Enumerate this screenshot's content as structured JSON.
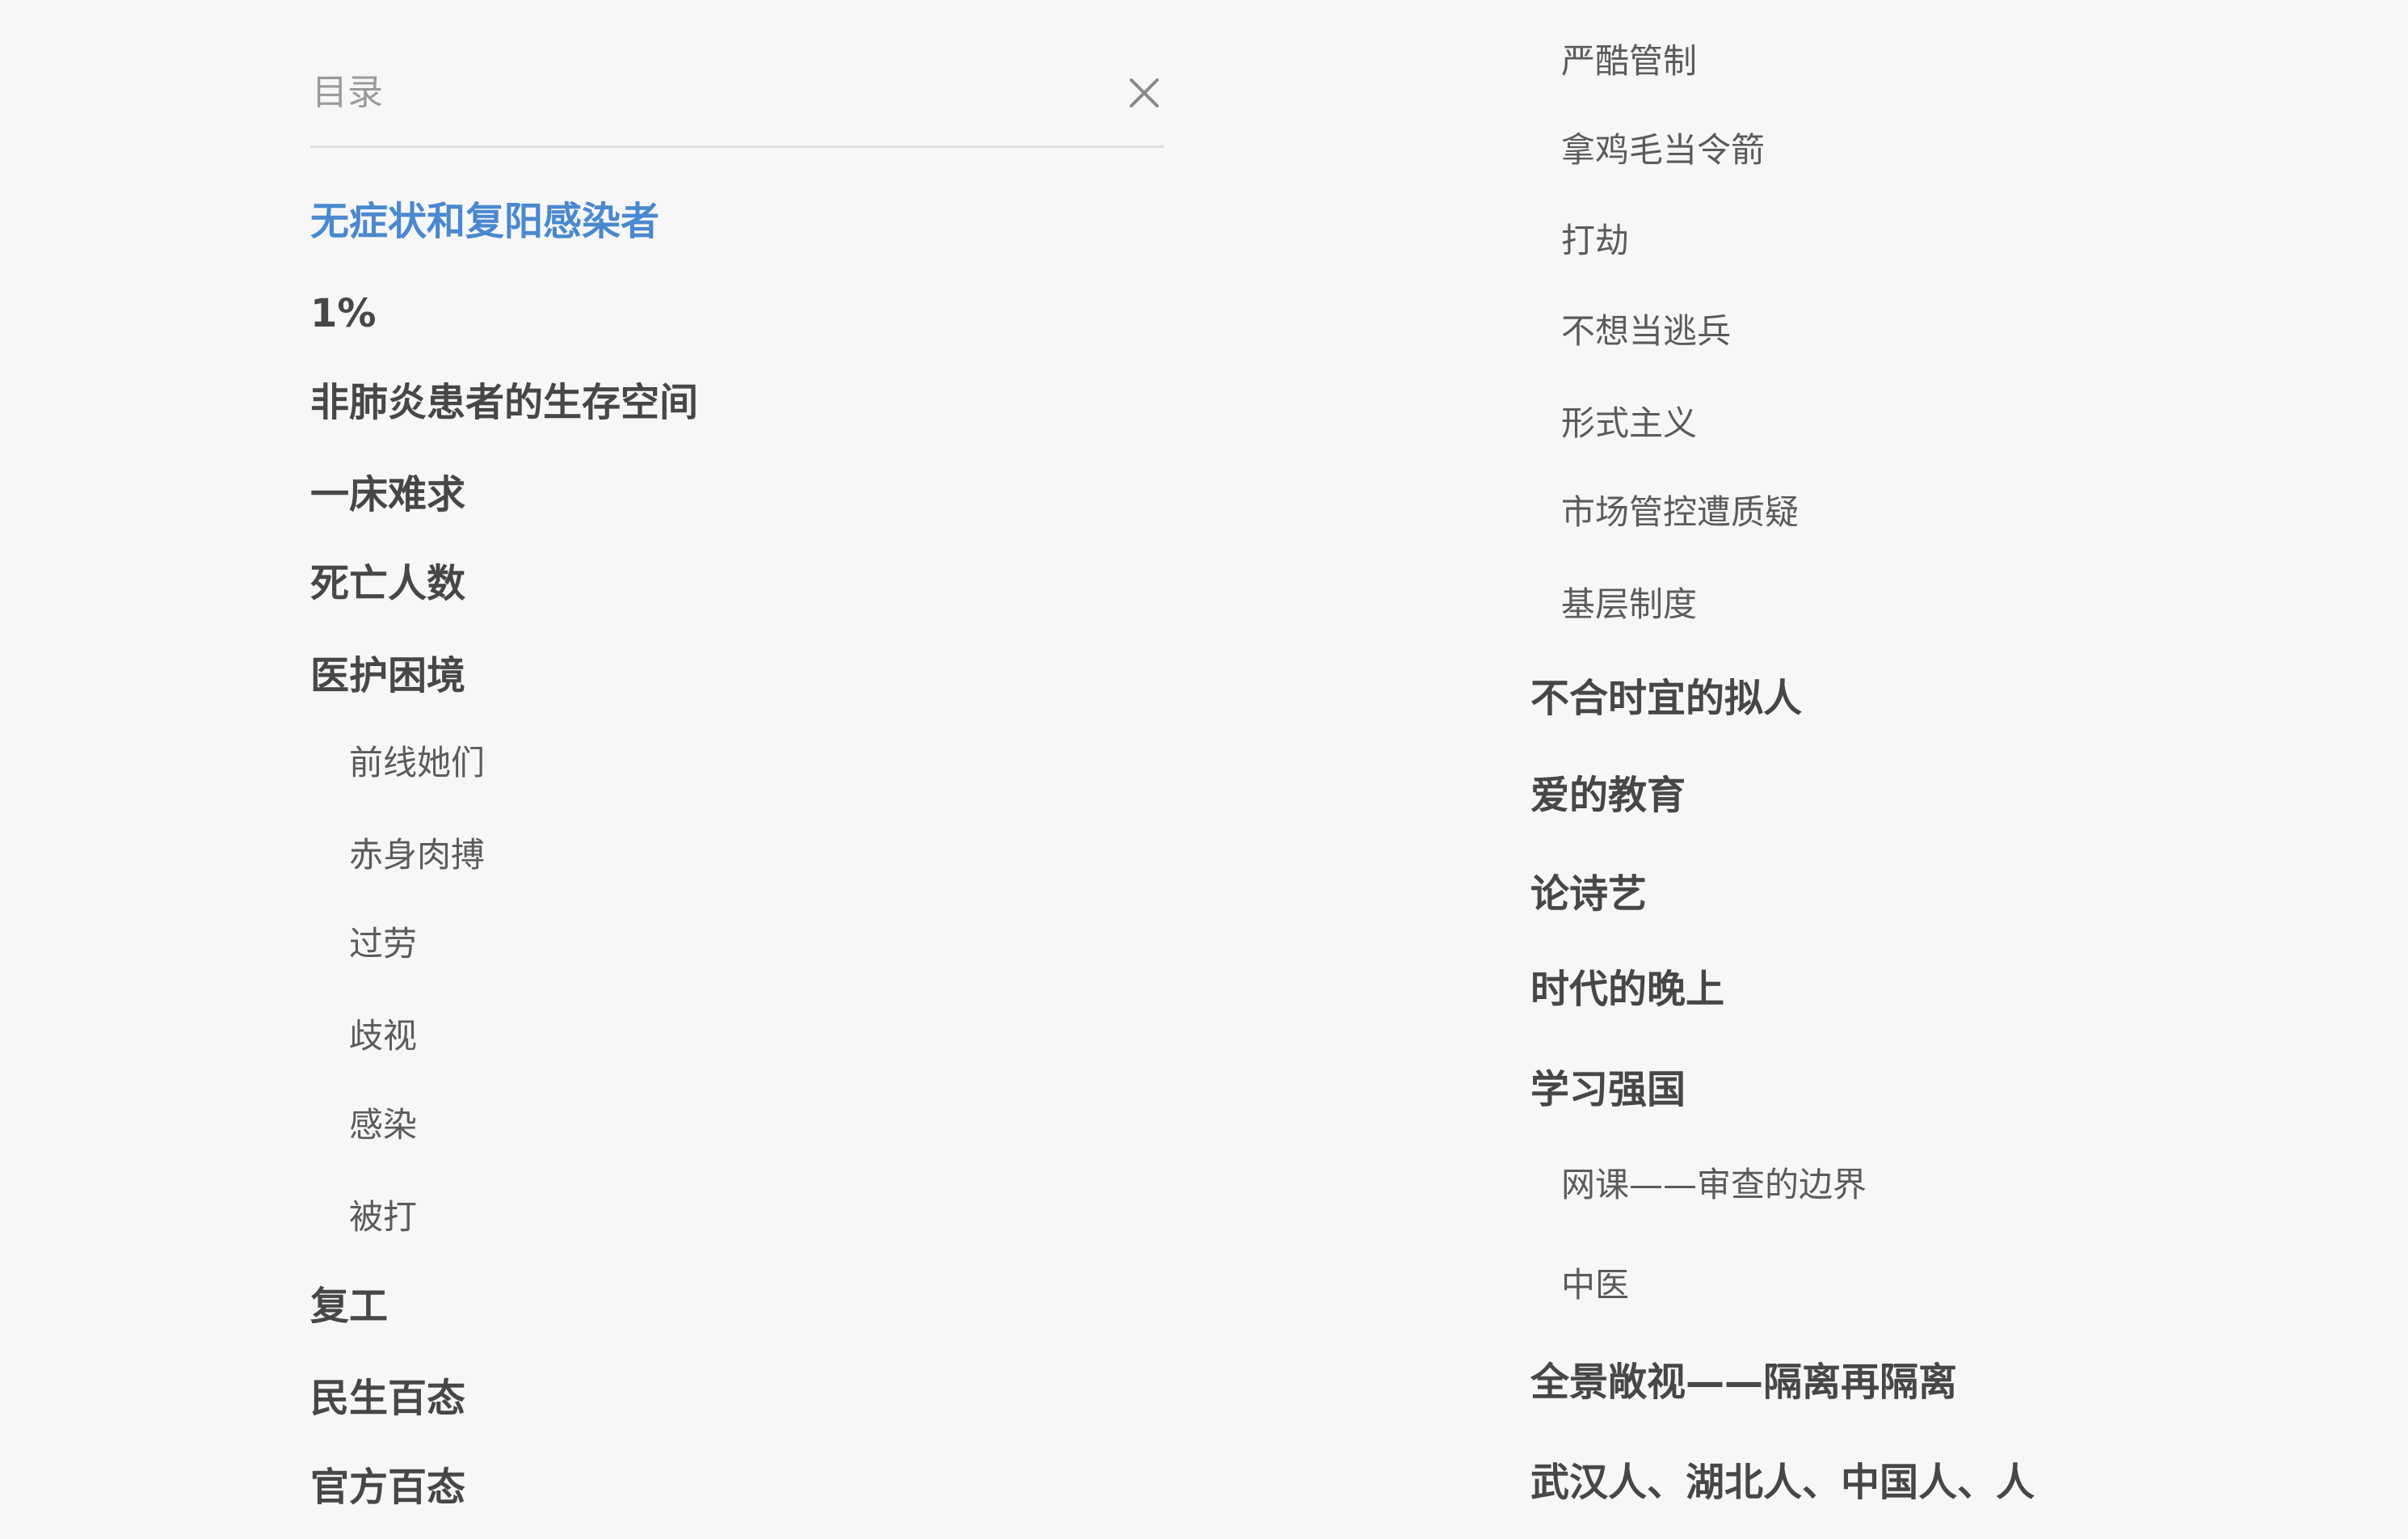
{
  "header": {
    "title": "目录",
    "close_icon": "close-icon"
  },
  "colors": {
    "background": "#f7f7f7",
    "active": "#4a89d0",
    "heading": "#474747",
    "subheading": "#5b5b5b",
    "header_text": "#9b9b9b",
    "divider": "#dedede"
  },
  "toc": {
    "left": [
      {
        "label": "无症状和复阳感染者",
        "level": 1,
        "active": true
      },
      {
        "label": "1%",
        "level": 1
      },
      {
        "label": "非肺炎患者的生存空间",
        "level": 1
      },
      {
        "label": "一床难求",
        "level": 1
      },
      {
        "label": "死亡人数",
        "level": 1
      },
      {
        "label": "医护困境",
        "level": 1
      },
      {
        "label": "前线她们",
        "level": 2
      },
      {
        "label": "赤身肉搏",
        "level": 2
      },
      {
        "label": "过劳",
        "level": 2
      },
      {
        "label": "歧视",
        "level": 2
      },
      {
        "label": "感染",
        "level": 2
      },
      {
        "label": "被打",
        "level": 2
      },
      {
        "label": "复工",
        "level": 1
      },
      {
        "label": "民生百态",
        "level": 1
      },
      {
        "label": "官方百态",
        "level": 1
      }
    ],
    "right": [
      {
        "label": "严酷管制",
        "level": 2
      },
      {
        "label": "拿鸡毛当令箭",
        "level": 2
      },
      {
        "label": "打劫",
        "level": 2
      },
      {
        "label": "不想当逃兵",
        "level": 2
      },
      {
        "label": "形式主义",
        "level": 2
      },
      {
        "label": "市场管控遭质疑",
        "level": 2
      },
      {
        "label": "基层制度",
        "level": 2
      },
      {
        "label": "不合时宜的拟人",
        "level": 1
      },
      {
        "label": "爱的教育",
        "level": 1
      },
      {
        "label": "论诗艺",
        "level": 1
      },
      {
        "label": "时代的晚上",
        "level": 1
      },
      {
        "label": "学习强国",
        "level": 1
      },
      {
        "label": "网课——审查的边界",
        "level": 2
      },
      {
        "label": "中医",
        "level": 2
      },
      {
        "label": "全景敞视——隔离再隔离",
        "level": 1
      },
      {
        "label": "武汉人、湖北人、中国人、人",
        "level": 1
      }
    ]
  }
}
